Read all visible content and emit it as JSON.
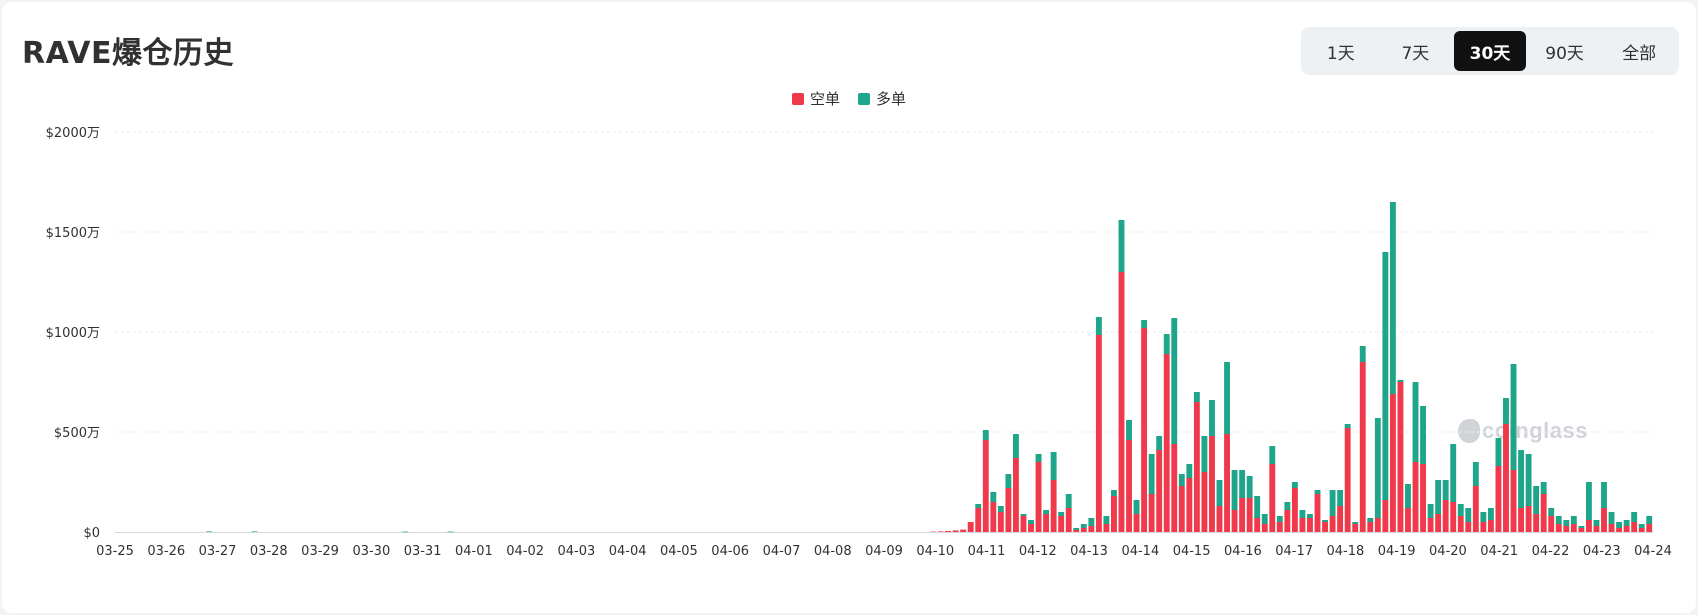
{
  "header": {
    "title": "RAVE爆仓历史"
  },
  "range_tabs": {
    "items": [
      "1天",
      "7天",
      "30天",
      "90天",
      "全部"
    ],
    "active": "30天"
  },
  "legend": [
    {
      "label": "空单",
      "color": "#f0394b"
    },
    {
      "label": "多单",
      "color": "#1fa58a"
    }
  ],
  "watermark": "coinglass",
  "chart_data": {
    "type": "bar",
    "stacked": true,
    "unit": "万美元",
    "ylim": [
      0,
      2000
    ],
    "yticks": [
      0,
      500,
      1000,
      1500,
      2000
    ],
    "ytick_labels": [
      "$0",
      "$500万",
      "$1000万",
      "$1500万",
      "$2000万"
    ],
    "xtick_labels": [
      "03-25",
      "03-26",
      "03-27",
      "03-28",
      "03-29",
      "03-30",
      "03-31",
      "04-01",
      "04-02",
      "04-03",
      "04-04",
      "04-05",
      "04-06",
      "04-07",
      "04-08",
      "04-09",
      "04-10",
      "04-11",
      "04-12",
      "04-13",
      "04-14",
      "04-15",
      "04-16",
      "04-17",
      "04-18",
      "04-19",
      "04-20",
      "04-21",
      "04-22",
      "04-23",
      "04-24"
    ],
    "grid": true,
    "legend_position": "top-center",
    "bars_per_day": 6,
    "series": [
      {
        "name": "空单",
        "color": "#f0394b",
        "values": [
          0,
          0,
          0,
          0,
          0,
          0,
          0,
          0,
          0,
          0,
          0,
          0,
          0,
          0,
          0,
          0,
          0,
          0,
          0,
          0,
          0,
          0,
          0,
          0,
          0,
          0,
          0,
          0,
          0,
          0,
          0,
          0,
          0,
          0,
          0,
          0,
          0,
          0,
          0,
          0,
          0,
          0,
          0,
          0,
          0,
          0,
          0,
          0,
          0,
          0,
          0,
          0,
          0,
          0,
          0,
          0,
          0,
          0,
          0,
          0,
          0,
          0,
          0,
          0,
          0,
          0,
          0,
          0,
          0,
          0,
          0,
          0,
          0,
          0,
          0,
          0,
          0,
          0,
          0,
          0,
          0,
          0,
          0,
          0,
          0,
          0,
          0,
          0,
          0,
          0,
          0,
          0,
          0,
          0,
          0,
          0,
          0,
          0,
          0,
          0,
          0,
          0,
          0,
          0,
          0,
          0,
          0,
          0,
          2,
          3,
          5,
          8,
          12,
          50,
          120,
          460,
          150,
          100,
          220,
          370,
          80,
          40,
          350,
          90,
          260,
          80,
          120,
          10,
          20,
          30,
          985,
          40,
          180,
          1300,
          460,
          90,
          1020,
          190,
          410,
          890,
          440,
          230,
          270,
          650,
          300,
          480,
          130,
          490,
          110,
          170,
          170,
          70,
          40,
          340,
          50,
          110,
          220,
          70,
          70,
          190,
          50,
          80,
          130,
          520,
          40,
          850,
          50,
          70,
          160,
          690,
          750,
          120,
          350,
          340,
          70,
          90,
          160,
          150,
          80,
          50,
          230,
          50,
          60,
          330,
          540,
          310,
          120,
          130,
          90,
          190,
          80,
          40,
          30,
          40,
          20,
          60,
          30,
          120,
          40,
          20,
          30,
          50,
          20,
          40
        ]
      },
      {
        "name": "多单",
        "color": "#1fa58a",
        "values": [
          0,
          0,
          0,
          0,
          0,
          0,
          0,
          0,
          0,
          0,
          0,
          0,
          3,
          0,
          0,
          0,
          0,
          0,
          3,
          0,
          0,
          0,
          0,
          0,
          0,
          0,
          0,
          0,
          0,
          0,
          0,
          0,
          0,
          0,
          0,
          0,
          0,
          0,
          2,
          0,
          0,
          0,
          0,
          0,
          2,
          0,
          0,
          0,
          0,
          0,
          0,
          0,
          0,
          0,
          0,
          0,
          0,
          0,
          0,
          0,
          0,
          0,
          0,
          0,
          0,
          0,
          0,
          0,
          0,
          0,
          0,
          0,
          0,
          0,
          0,
          0,
          0,
          0,
          0,
          0,
          0,
          0,
          0,
          0,
          0,
          0,
          0,
          0,
          0,
          0,
          0,
          0,
          0,
          0,
          0,
          0,
          0,
          0,
          0,
          0,
          0,
          0,
          0,
          0,
          0,
          0,
          0,
          0,
          0,
          0,
          0,
          0,
          0,
          0,
          20,
          50,
          50,
          30,
          70,
          120,
          10,
          20,
          40,
          20,
          140,
          20,
          70,
          10,
          20,
          40,
          90,
          40,
          30,
          260,
          100,
          70,
          40,
          200,
          70,
          100,
          630,
          60,
          70,
          50,
          180,
          180,
          130,
          360,
          200,
          140,
          110,
          110,
          50,
          90,
          30,
          40,
          30,
          40,
          20,
          20,
          10,
          130,
          80,
          20,
          10,
          80,
          20,
          500,
          1240,
          960,
          10,
          120,
          400,
          290,
          70,
          170,
          100,
          290,
          60,
          70,
          120,
          50,
          60,
          140,
          130,
          530,
          290,
          260,
          140,
          60,
          40,
          40,
          30,
          40,
          10,
          190,
          30,
          130,
          60,
          30,
          30,
          50,
          20,
          40
        ]
      }
    ]
  }
}
